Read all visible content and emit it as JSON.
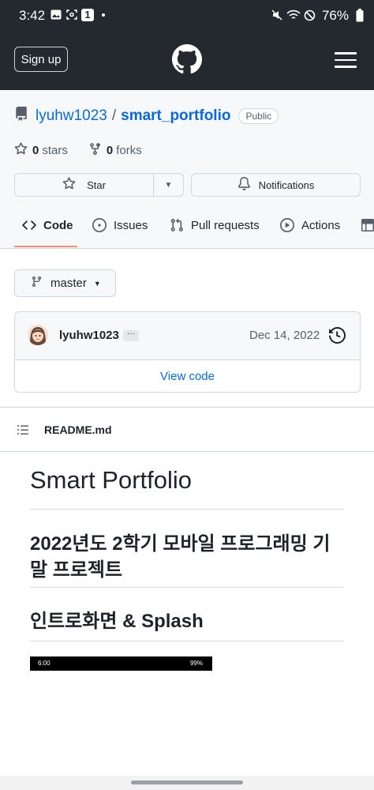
{
  "status_bar": {
    "time": "3:42",
    "notif_count": "1",
    "battery": "76%"
  },
  "header": {
    "signup_label": "Sign up"
  },
  "repo": {
    "owner": "lyuhw1023",
    "separator": "/",
    "name": "smart_portfolio",
    "visibility": "Public",
    "stars_count": "0",
    "stars_label": "stars",
    "forks_count": "0",
    "forks_label": "forks",
    "star_button": "Star",
    "notifications_button": "Notifications"
  },
  "tabs": [
    {
      "label": "Code",
      "icon": "code-icon"
    },
    {
      "label": "Issues",
      "icon": "issue-icon"
    },
    {
      "label": "Pull requests",
      "icon": "pull-request-icon"
    },
    {
      "label": "Actions",
      "icon": "play-icon"
    }
  ],
  "branch": {
    "name": "master"
  },
  "commit": {
    "author": "lyuhw1023",
    "ellipsis": "···",
    "date": "Dec 14, 2022",
    "view_code": "View code"
  },
  "readme": {
    "filename": "README.md",
    "h1": "Smart Portfolio",
    "h2_line1": "2022년도 2학기 모바일 프로그래밍 기",
    "h2_line2": "말 프로젝트",
    "h2_second": "인트로화면 & Splash",
    "screenshot_time": "6:00",
    "screenshot_battery": "99%"
  },
  "colors": {
    "header_bg": "#24292f",
    "link": "#0969da",
    "tab_underline": "#fd8c73"
  }
}
